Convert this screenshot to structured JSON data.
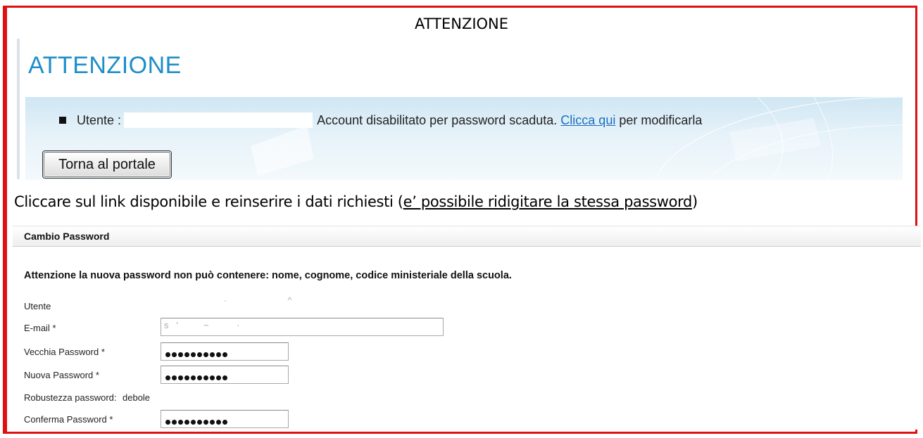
{
  "doc": {
    "top_title": "ATTENZIONE",
    "instruction_plain": "Cliccare sul link disponibile e reinserire i dati richiesti (",
    "instruction_underlined": "e’ possibile ridigitare la stessa password",
    "instruction_end": ")"
  },
  "alert": {
    "heading": "ATTENZIONE",
    "message_prefix": "Utente :",
    "message_middle": "Account disabilitato per password scaduta.",
    "link_text": "Clicca qui",
    "message_suffix": "per modificarla",
    "back_button": "Torna al portale"
  },
  "password_form": {
    "header": "Cambio Password",
    "warning": "Attenzione la nuova password non può contenere: nome, cognome, codice ministeriale della scuola.",
    "fields": [
      {
        "label": "Utente"
      },
      {
        "label": "E-mail *"
      },
      {
        "label": "Vecchia Password *"
      },
      {
        "label": "Nuova Password *"
      },
      {
        "label": "Robustezza password:",
        "value": "debole"
      },
      {
        "label": "Conferma Password *"
      }
    ]
  },
  "colors": {
    "frame_border": "#e01010",
    "heading_blue": "#1e8ec8",
    "link_blue": "#1a6fc2"
  }
}
